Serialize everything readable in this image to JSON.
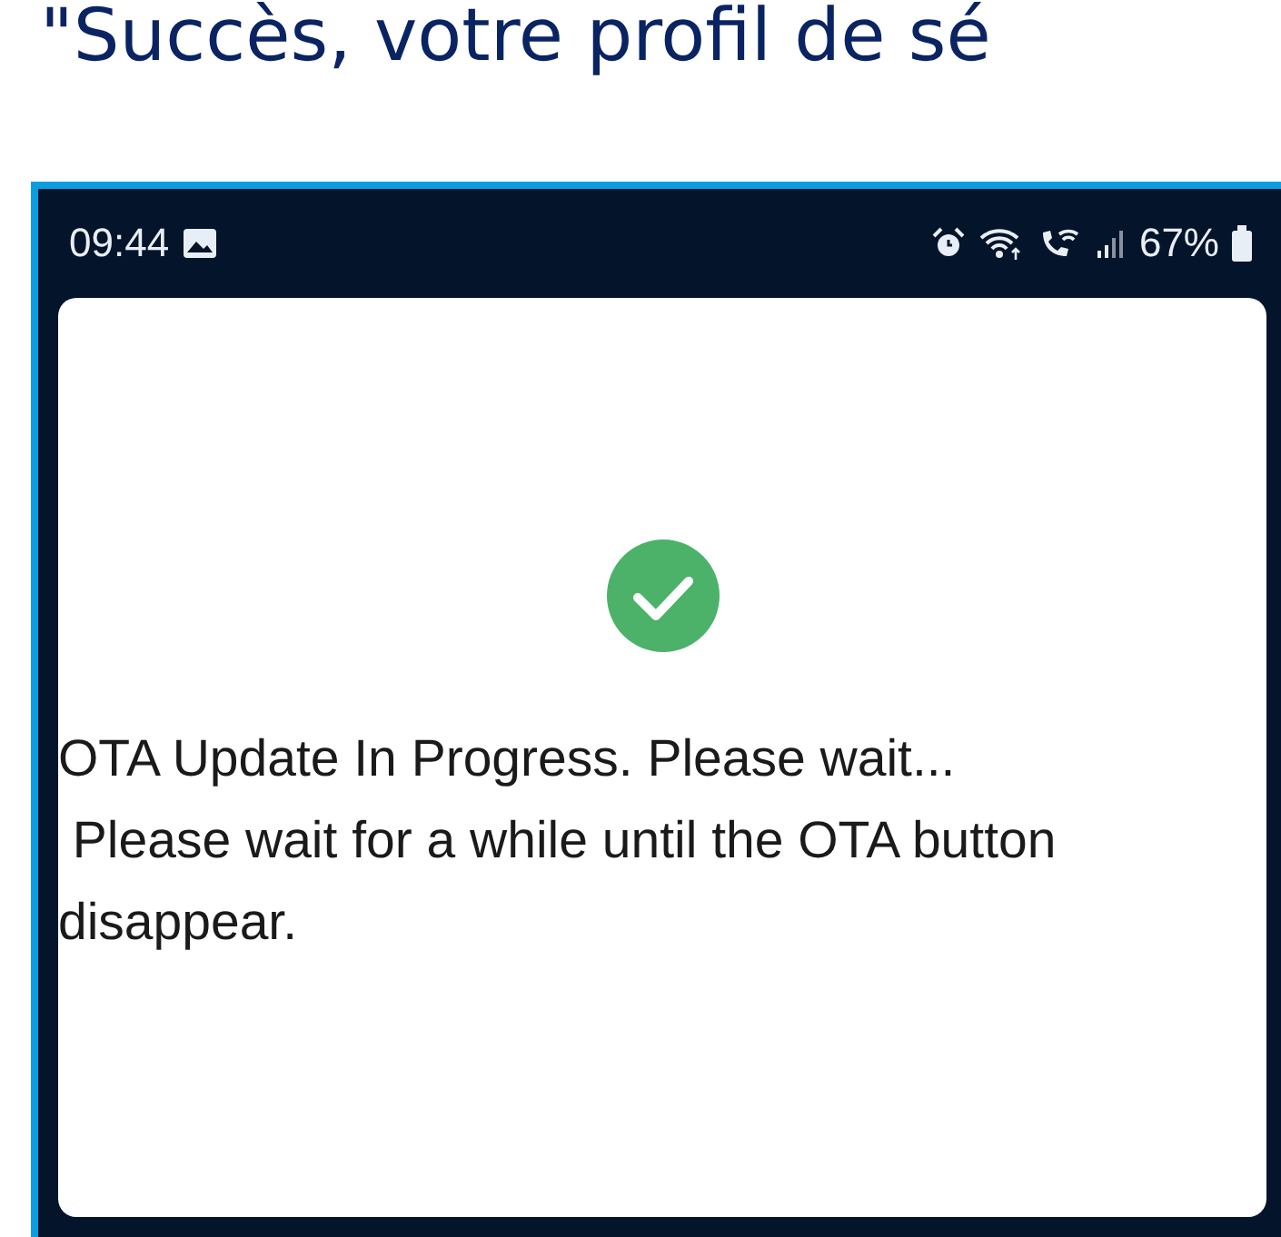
{
  "heading": "\"Succès, votre profil de sé",
  "status_bar": {
    "time": "09:44",
    "battery": "67%"
  },
  "dialog": {
    "message": "OTA Update In Progress. Please wait...\n Please wait for a while until the OTA button disappear."
  }
}
